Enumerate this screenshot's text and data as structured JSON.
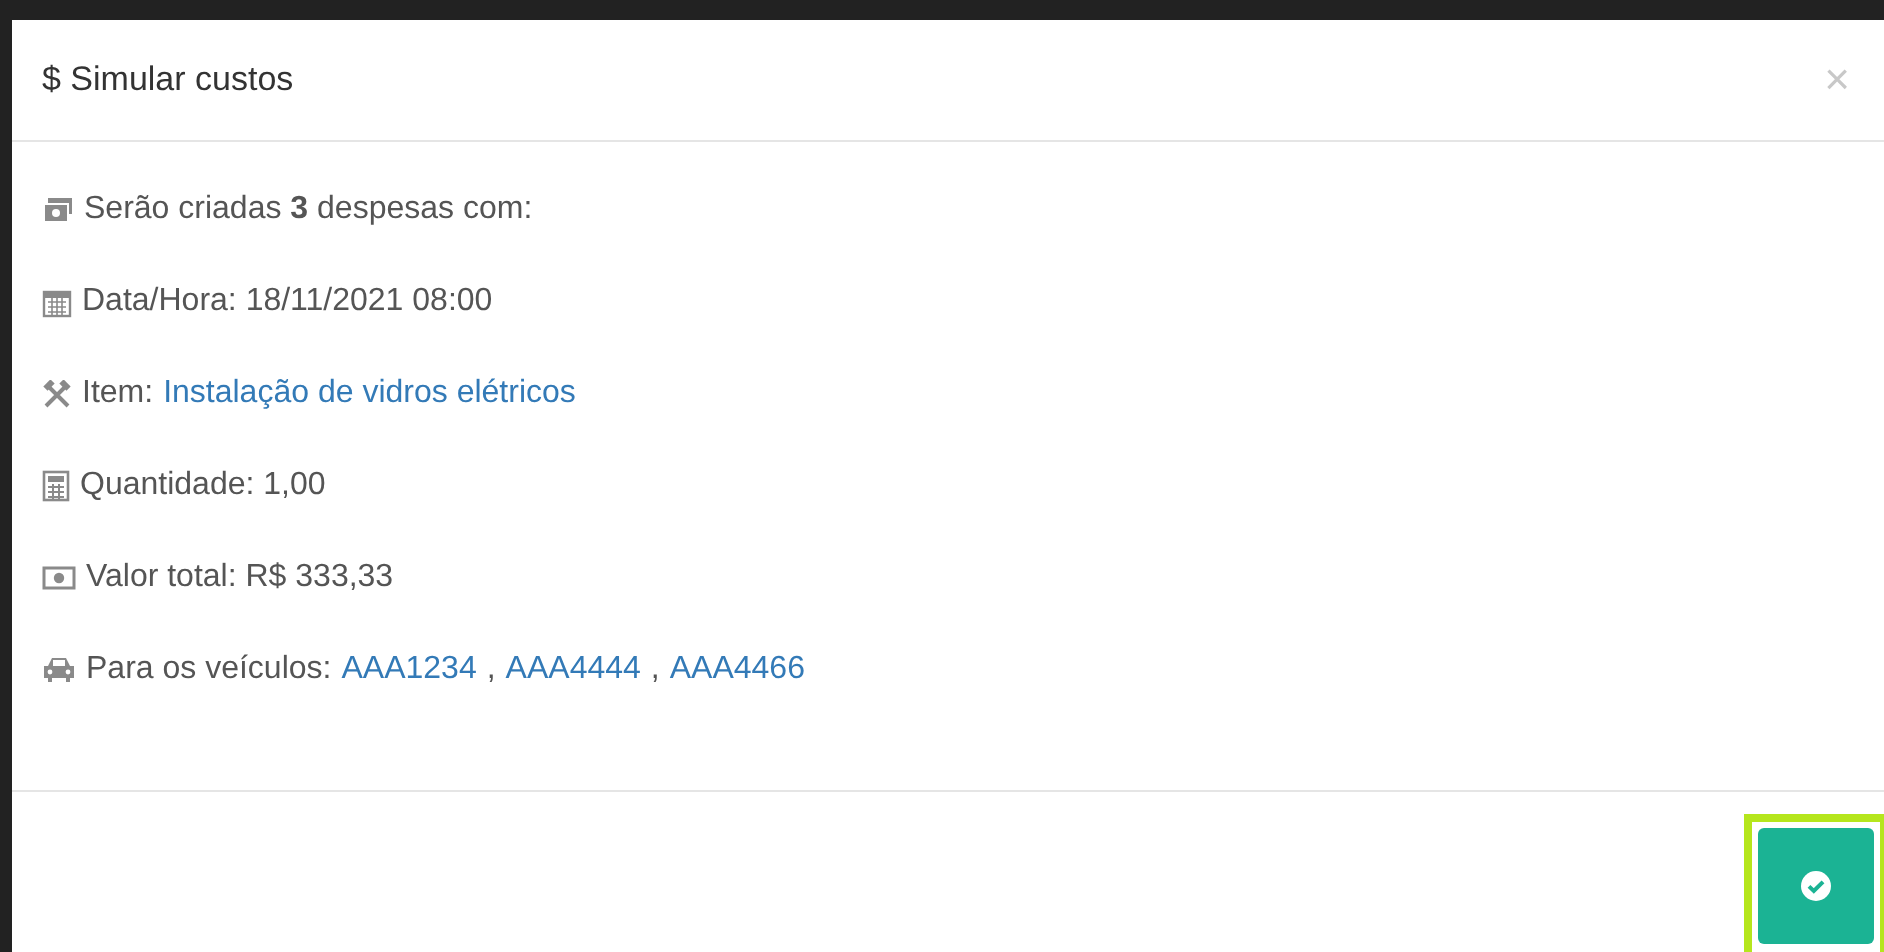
{
  "modal": {
    "title": "$ Simular custos",
    "close_label": "×",
    "rows": [
      {
        "kind": "text",
        "text": "Serão criadas **3** despesas com:"
      },
      {
        "kind": "text",
        "text": "Data/Hora: 18/11/2021 08:00"
      },
      {
        "kind": "links",
        "label": "Item:",
        "links": [
          "Instalação de vidros elétricos"
        ]
      },
      {
        "kind": "text",
        "text": "Quantidade: 1,00"
      },
      {
        "kind": "text",
        "text": "Valor total: R$ 333,33"
      },
      {
        "kind": "links",
        "label": "Para os veículos:",
        "links": [
          "AAA1234",
          "AAA4444",
          "AAA4466"
        ],
        "separator": ","
      }
    ],
    "confirm_button": {
      "highlighted": true
    }
  }
}
